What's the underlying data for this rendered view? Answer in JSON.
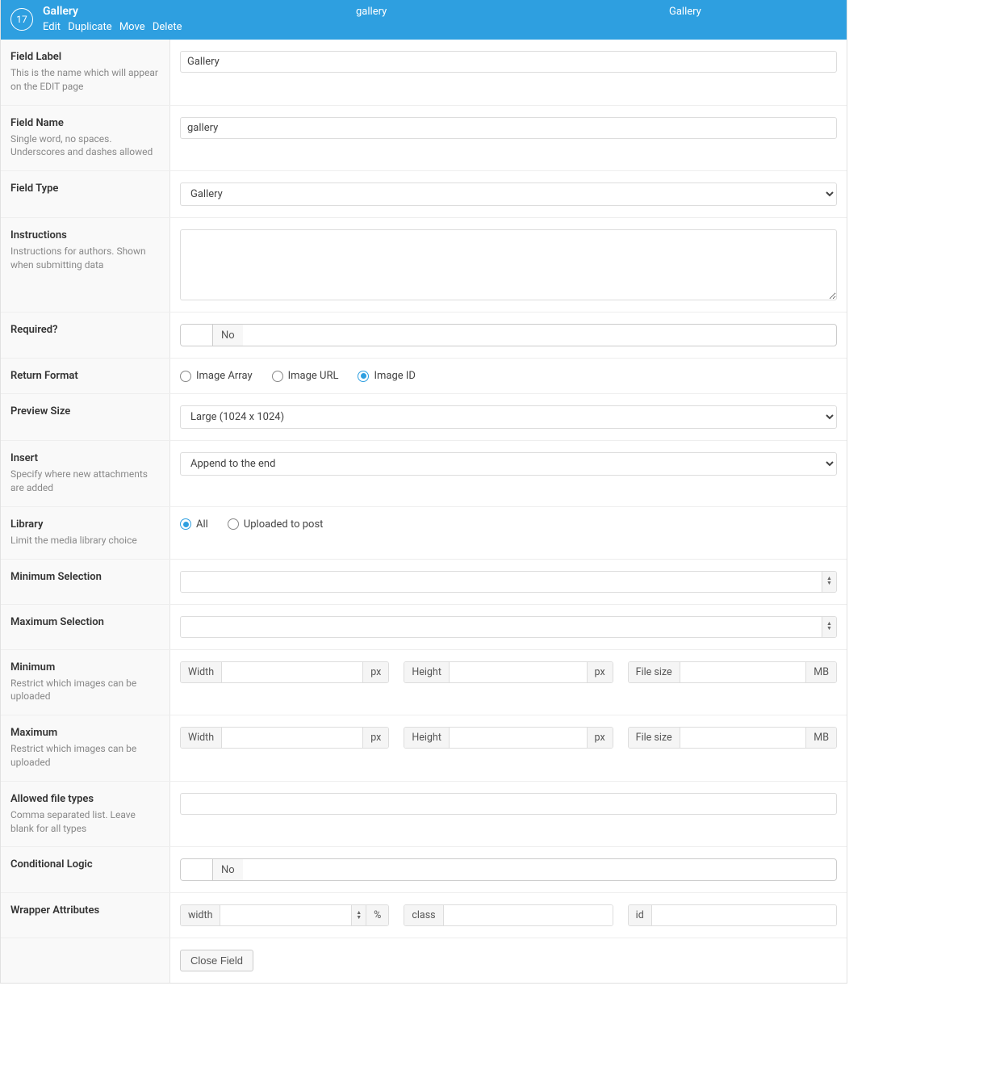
{
  "header": {
    "order": "17",
    "title": "Gallery",
    "name_col": "gallery",
    "type_col": "Gallery",
    "actions": {
      "edit": "Edit",
      "duplicate": "Duplicate",
      "move": "Move",
      "delete": "Delete"
    }
  },
  "field_label": {
    "label": "Field Label",
    "desc": "This is the name which will appear on the EDIT page",
    "value": "Gallery"
  },
  "field_name": {
    "label": "Field Name",
    "desc": "Single word, no spaces. Underscores and dashes allowed",
    "value": "gallery"
  },
  "field_type": {
    "label": "Field Type",
    "value": "Gallery"
  },
  "instructions": {
    "label": "Instructions",
    "desc": "Instructions for authors. Shown when submitting data",
    "value": ""
  },
  "required": {
    "label": "Required?",
    "state": "No"
  },
  "return_format": {
    "label": "Return Format",
    "options": {
      "array": "Image Array",
      "url": "Image URL",
      "id": "Image ID"
    },
    "selected": "id"
  },
  "preview_size": {
    "label": "Preview Size",
    "value": "Large (1024 x 1024)"
  },
  "insert": {
    "label": "Insert",
    "desc": "Specify where new attachments are added",
    "value": "Append to the end"
  },
  "library": {
    "label": "Library",
    "desc": "Limit the media library choice",
    "options": {
      "all": "All",
      "uploaded": "Uploaded to post"
    },
    "selected": "all"
  },
  "min_selection": {
    "label": "Minimum Selection",
    "value": ""
  },
  "max_selection": {
    "label": "Maximum Selection",
    "value": ""
  },
  "min_dims": {
    "label": "Minimum",
    "desc": "Restrict which images can be uploaded",
    "width_pre": "Width",
    "width_suf": "px",
    "height_pre": "Height",
    "height_suf": "px",
    "size_pre": "File size",
    "size_suf": "MB"
  },
  "max_dims": {
    "label": "Maximum",
    "desc": "Restrict which images can be uploaded",
    "width_pre": "Width",
    "width_suf": "px",
    "height_pre": "Height",
    "height_suf": "px",
    "size_pre": "File size",
    "size_suf": "MB"
  },
  "allowed_types": {
    "label": "Allowed file types",
    "desc": "Comma separated list. Leave blank for all types",
    "value": ""
  },
  "cond_logic": {
    "label": "Conditional Logic",
    "state": "No"
  },
  "wrapper": {
    "label": "Wrapper Attributes",
    "width_pre": "width",
    "width_suf": "%",
    "class_pre": "class",
    "id_pre": "id"
  },
  "footer": {
    "close": "Close Field"
  }
}
